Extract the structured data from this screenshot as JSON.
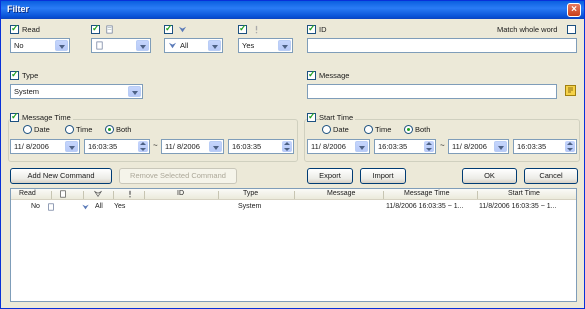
{
  "window": {
    "title": "Filter",
    "close": "×"
  },
  "filters": {
    "read": {
      "label": "Read",
      "value": "No"
    },
    "attachment": {
      "value": ""
    },
    "flag": {
      "value": "All"
    },
    "importance": {
      "value": "Yes"
    },
    "id": {
      "label": "ID",
      "value": "",
      "match_whole_word_label": "Match whole word"
    },
    "type": {
      "label": "Type",
      "value": "System"
    },
    "message": {
      "label": "Message",
      "value": ""
    }
  },
  "message_time": {
    "label": "Message Time",
    "radio_date": "Date",
    "radio_time": "Time",
    "radio_both": "Both",
    "from_date": "11/ 8/2006",
    "from_time": "16:03:35",
    "dash": "~",
    "to_date": "11/ 8/2006",
    "to_time": "16:03:35"
  },
  "start_time": {
    "label": "Start Time",
    "radio_date": "Date",
    "radio_time": "Time",
    "radio_both": "Both",
    "from_date": "11/ 8/2006",
    "from_time": "16:03:35",
    "dash": "~",
    "to_date": "11/ 8/2006",
    "to_time": "16:03:35"
  },
  "buttons": {
    "add_new_command": "Add New Command",
    "remove_selected_command": "Remove Selected Command",
    "export": "Export",
    "import": "Import",
    "ok": "OK",
    "cancel": "Cancel"
  },
  "table": {
    "headers": {
      "read": "Read",
      "id": "ID",
      "type": "Type",
      "message": "Message",
      "message_time": "Message Time",
      "start_time": "Start Time"
    },
    "rows": [
      {
        "read": "No",
        "flag": "All",
        "importance": "Yes",
        "id": "",
        "type": "System",
        "message": "",
        "message_time": "11/8/2006 16:03:35 ~ 1...",
        "start_time": "11/8/2006 16:03:35 ~ 1..."
      }
    ]
  },
  "colors": {
    "title_bar": "#0a5fe0",
    "check": "#21a121",
    "window_bg": "#ece9d8"
  }
}
